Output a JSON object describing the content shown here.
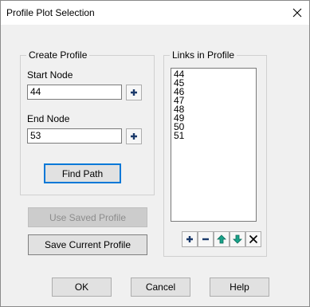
{
  "window": {
    "title": "Profile Plot Selection"
  },
  "create_profile": {
    "group_label": "Create Profile",
    "start_node_label": "Start Node",
    "start_node_value": "44",
    "end_node_label": "End Node",
    "end_node_value": "53",
    "find_path_label": "Find Path"
  },
  "links": {
    "group_label": "Links in Profile",
    "items": [
      "44",
      "45",
      "46",
      "47",
      "48",
      "49",
      "50",
      "51"
    ]
  },
  "use_saved_profile_label": "Use Saved Profile",
  "save_current_profile_label": "Save Current Profile",
  "footer": {
    "ok_label": "OK",
    "cancel_label": "Cancel",
    "help_label": "Help"
  },
  "icons": {
    "close": "close-icon",
    "plus": "plus-icon",
    "minus": "minus-icon",
    "up": "arrow-up-icon",
    "down": "arrow-down-icon",
    "delete": "x-delete-icon"
  },
  "colors": {
    "plus_icon": "#1b3a6b",
    "arrow_icon": "#1aa38a",
    "default_border": "#0078d7"
  }
}
